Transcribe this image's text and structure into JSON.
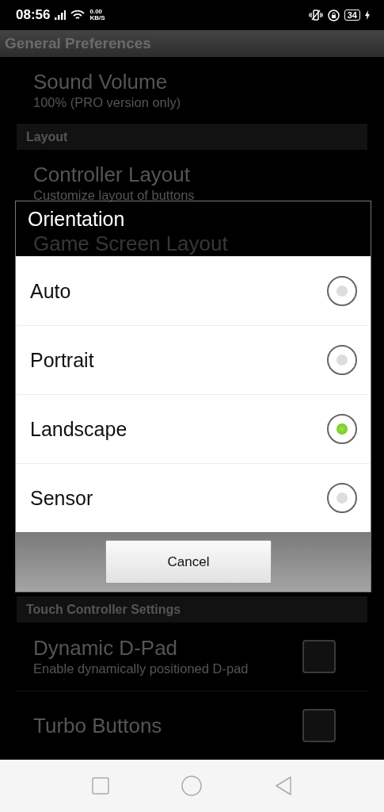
{
  "status_bar": {
    "time": "08:56",
    "speed_value": "0.00",
    "speed_unit": "KB/S",
    "battery": "34"
  },
  "app_bar": {
    "title": "General Preferences"
  },
  "preferences": [
    {
      "kind": "item",
      "title": "Sound Volume",
      "summary": "100% (PRO version only)"
    },
    {
      "kind": "header",
      "title": "Layout"
    },
    {
      "kind": "item",
      "title": "Controller Layout",
      "summary": "Customize layout of buttons"
    },
    {
      "kind": "item",
      "title": "Game Screen Layout"
    },
    {
      "kind": "spacer"
    },
    {
      "kind": "header",
      "title": "Touch Controller Settings"
    },
    {
      "kind": "checkbox",
      "title": "Dynamic D-Pad",
      "summary": "Enable dynamically positioned D-pad",
      "checked": false
    },
    {
      "kind": "checkbox",
      "title": "Turbo Buttons",
      "checked": false
    }
  ],
  "dialog": {
    "title": "Orientation",
    "options": [
      {
        "label": "Auto",
        "selected": false
      },
      {
        "label": "Portrait",
        "selected": false
      },
      {
        "label": "Landscape",
        "selected": true
      },
      {
        "label": "Sensor",
        "selected": false
      }
    ],
    "cancel": "Cancel"
  }
}
